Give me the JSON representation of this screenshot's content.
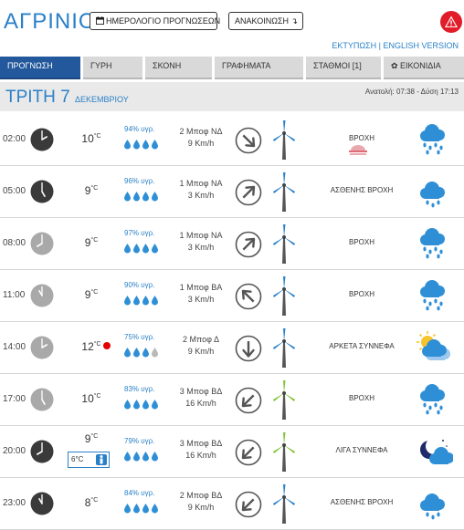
{
  "header": {
    "city": "ΑΓΡΙΝΙΟ",
    "calendar_button": "ΗΜΕΡΟΛΟΓΙΟ ΠΡΟΓΝΩΣΕΩΝ",
    "announcements_button": "ΑΝΑΚΟΙΝΩΣΗ",
    "print_link": "ΕΚΤΥΠΩΣΗ",
    "separator": " | ",
    "english_link": "ENGLISH VERSION",
    "warning_icon": "warning-triangle-icon",
    "calendar_icon": "calendar-icon"
  },
  "tabs": [
    {
      "label": "ΠΡΟΓΝΩΣΗ",
      "active": true
    },
    {
      "label": "ΓΥΡΗ"
    },
    {
      "label": "ΣΚΟΝΗ"
    },
    {
      "label": "ΓΡΑΦΗΜΑΤΑ"
    },
    {
      "label": "ΣΤΑΘΜΟΙ [1]"
    },
    {
      "label": "✿ ΕΙΚΟΝΙΔΙΑ"
    }
  ],
  "day": {
    "title": "ΤΡΙΤΗ 7",
    "month": "ΔΕΚΕΜΒΡΙΟΥ",
    "sun_times": "Ανατολή: 07:38 - Δύση 17:13"
  },
  "colors": {
    "accent": "#2a80c8",
    "tab_active": "#23599c",
    "tab_inactive": "#d9d9d9",
    "warning": "#e21d2a",
    "turbine_green": "#7ec234"
  },
  "rows": [
    {
      "time": "02:00",
      "clock_dark": true,
      "temp": "10",
      "unit": "°C",
      "humidity": "94% υγρ.",
      "drops": 4,
      "wind_bf": "2 Μποφ ΝΔ",
      "wind_kmh": "9 Km/h",
      "wind_to_deg": 45,
      "turbine": "blue",
      "desc": "ΒΡΟΧΗ",
      "fog": true,
      "icon": "rain-cloud-icon"
    },
    {
      "time": "05:00",
      "clock_dark": true,
      "temp": "9",
      "unit": "°C",
      "humidity": "96% υγρ.",
      "drops": 4,
      "wind_bf": "1 Μποφ ΝΑ",
      "wind_kmh": "3 Km/h",
      "wind_to_deg": 315,
      "turbine": "blue",
      "desc": "ΑΣΘΕΝΗΣ ΒΡΟΧΗ",
      "icon": "light-rain-cloud-icon"
    },
    {
      "time": "08:00",
      "clock_dark": false,
      "temp": "9",
      "unit": "°C",
      "humidity": "97% υγρ.",
      "drops": 4,
      "wind_bf": "1 Μποφ ΝΑ",
      "wind_kmh": "3 Km/h",
      "wind_to_deg": 315,
      "turbine": "blue",
      "desc": "ΒΡΟΧΗ",
      "icon": "rain-cloud-icon"
    },
    {
      "time": "11:00",
      "clock_dark": false,
      "temp": "9",
      "unit": "°C",
      "humidity": "90% υγρ.",
      "drops": 4,
      "wind_bf": "1 Μποφ ΒΑ",
      "wind_kmh": "3 Km/h",
      "wind_to_deg": 225,
      "turbine": "blue",
      "desc": "ΒΡΟΧΗ",
      "icon": "rain-cloud-icon"
    },
    {
      "time": "14:00",
      "clock_dark": false,
      "temp": "12",
      "unit": "°C",
      "red_dot": true,
      "humidity": "75% υγρ.",
      "drops": 3,
      "wind_bf": "2 Μποφ Δ",
      "wind_kmh": "9 Km/h",
      "wind_to_deg": 90,
      "turbine": "blue",
      "desc": "ΑΡΚΕΤΑ ΣΥΝΝΕΦΑ",
      "icon": "sun-clouds-icon"
    },
    {
      "time": "17:00",
      "clock_dark": false,
      "temp": "10",
      "unit": "°C",
      "humidity": "83% υγρ.",
      "drops": 4,
      "wind_bf": "3 Μποφ ΒΔ",
      "wind_kmh": "16 Km/h",
      "wind_to_deg": 135,
      "turbine": "green",
      "desc": "ΒΡΟΧΗ",
      "icon": "rain-cloud-icon"
    },
    {
      "time": "20:00",
      "clock_dark": true,
      "temp": "9",
      "unit": "°C",
      "feels_like": "6°C",
      "humidity": "79% υγρ.",
      "drops": 4,
      "wind_bf": "3 Μποφ ΒΔ",
      "wind_kmh": "16 Km/h",
      "wind_to_deg": 135,
      "turbine": "green",
      "desc": "ΛΙΓΑ ΣΥΝΝΕΦΑ",
      "icon": "moon-cloud-icon"
    },
    {
      "time": "23:00",
      "clock_dark": true,
      "temp": "8",
      "unit": "°C",
      "humidity": "84% υγρ.",
      "drops": 4,
      "wind_bf": "2 Μποφ ΒΔ",
      "wind_kmh": "9 Km/h",
      "wind_to_deg": 135,
      "turbine": "blue",
      "desc": "ΑΣΘΕΝΗΣ ΒΡΟΧΗ",
      "icon": "light-rain-cloud-icon"
    }
  ]
}
